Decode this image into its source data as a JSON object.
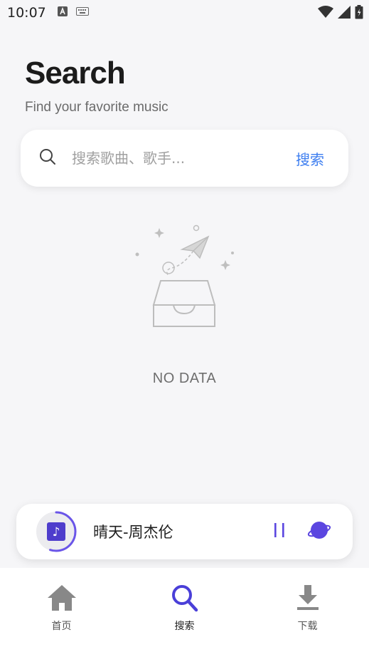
{
  "status_bar": {
    "time": "10:07"
  },
  "header": {
    "title": "Search",
    "subtitle": "Find your favorite music"
  },
  "search": {
    "placeholder": "搜索歌曲、歌手...",
    "value": "",
    "button_label": "搜索"
  },
  "empty_state": {
    "text": "NO DATA"
  },
  "player": {
    "song_title": "晴天-周杰伦",
    "progress": 0.55,
    "state": "playing",
    "accent_color": "#5b46e0"
  },
  "bottom_nav": {
    "items": [
      {
        "label": "首页",
        "icon": "home-icon",
        "active": false
      },
      {
        "label": "搜索",
        "icon": "search-icon",
        "active": true
      },
      {
        "label": "下载",
        "icon": "download-icon",
        "active": false
      }
    ],
    "active_color": "#4a3fd8",
    "inactive_color": "#888888"
  }
}
